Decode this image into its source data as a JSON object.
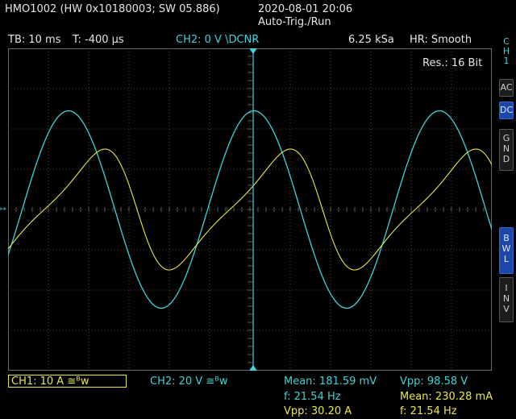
{
  "header": {
    "device": "HMO1002 (HW 0x10180003; SW 05.886)",
    "datetime": "2020-08-01 20:06",
    "trigger_mode": "Auto-Trig./Run"
  },
  "infobar": {
    "timebase": "TB: 10 ms",
    "trigger_time": "T: -400 µs",
    "trigger_source": "CH2: 0 V \\DCNR",
    "sample_rate": "6.25 kSa",
    "acq_mode": "HR: Smooth"
  },
  "resolution": "Res.: 16 Bit",
  "side_panel": {
    "channel": [
      "C",
      "H",
      "1"
    ],
    "ac": "AC",
    "dc": "DC",
    "gnd": [
      "G",
      "N",
      "D"
    ],
    "bwl": [
      "B",
      "W",
      "L"
    ],
    "inv": [
      "I",
      "N",
      "V"
    ]
  },
  "bottom": {
    "ch1": "CH1: 10 A ≅ᴮw",
    "ch2": "CH2: 20 V ≅ᴮw",
    "ch2_mean": "Mean: 181.59 mV",
    "ch2_freq": "f: 21.54 Hz",
    "ch1_vpp": "Vpp: 30.20 A",
    "ch2_vpp": "Vpp: 98.58 V",
    "ch1_mean": "Mean: 230.28 mA",
    "ch1_freq": "f: 21.54 Hz"
  },
  "colors": {
    "ch1": "#e8e64a",
    "ch2": "#3fd3d8",
    "grid": "#4a4a4a",
    "active_button": "#1c46a8"
  },
  "chart_data": {
    "type": "line",
    "x_divisions": 12,
    "y_divisions": 8,
    "series": [
      {
        "channel": "CH2",
        "color": "#3fd3d8",
        "amplitude_div": 2.45,
        "period_div": 4.6,
        "phase_div": 0.35
      },
      {
        "channel": "CH1",
        "color": "#e8e64a",
        "amplitude_div": 1.5,
        "period_div": 4.6,
        "phase_div": 0.9
      }
    ]
  }
}
